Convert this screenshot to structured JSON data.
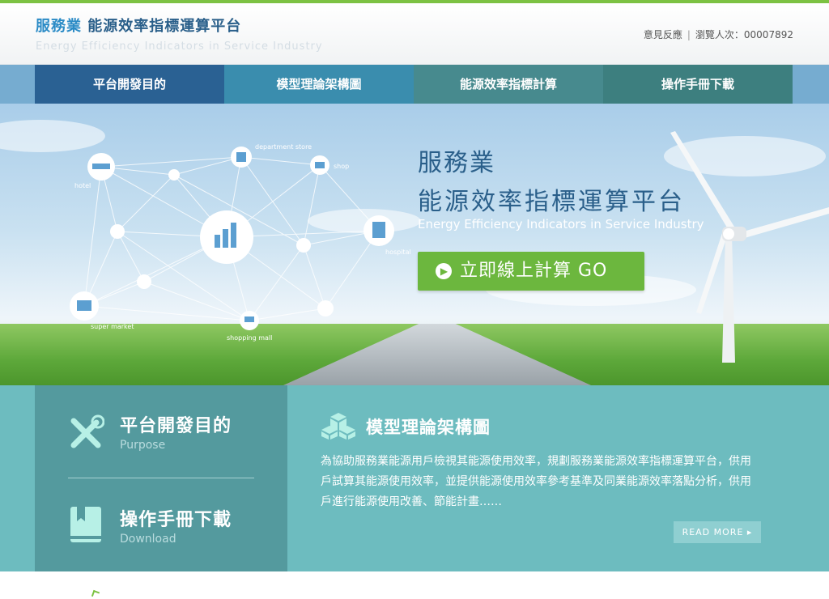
{
  "header": {
    "title_a": "服務業",
    "title_b": " 能源效率指標運算平台",
    "subtitle": "Energy Efficiency Indicators in Service Industry",
    "feedback": "意見反應",
    "separator": "|",
    "visits": "瀏覽人次：00007892"
  },
  "nav": [
    {
      "label": "平台開發目的",
      "color": "#2a6193"
    },
    {
      "label": "模型理論架構圖",
      "color": "#3a8dae"
    },
    {
      "label": "能源效率指標計算",
      "color": "#478a8e"
    },
    {
      "label": "操作手冊下載",
      "color": "#3d7f7f"
    }
  ],
  "hero": {
    "line1": "服務業",
    "line2": "能源效率指標運算平台",
    "subtitle": "Energy Efficiency Indicators in Service Industry",
    "go_label": "立即線上計算 GO",
    "network_labels": {
      "department": "department store",
      "shop": "shop",
      "hotel": "hotel",
      "hospital": "hospital",
      "supermarket": "super market",
      "mall": "shopping mall"
    }
  },
  "features": {
    "purpose_title": "平台開發目的",
    "purpose_sub": "Purpose",
    "download_title": "操作手冊下載",
    "download_sub": "Download",
    "model_title": "模型理論架構圖",
    "model_body": "為協助服務業能源用戶檢視其能源使用效率，規劃服務業能源效率指標運算平台，供用戶試算其能源使用效率，並提供能源使用效率參考基準及同業能源效率落點分析，供用戶進行能源使用改善、節能計畫……",
    "read_more": "READ MORE ▸"
  },
  "colors": {
    "accent_green": "#7dc243",
    "go_button": "#6cb73e",
    "teal": "#6dbcbf",
    "teal_dark": "#549a9e",
    "nav_bg": "#76acd0"
  }
}
